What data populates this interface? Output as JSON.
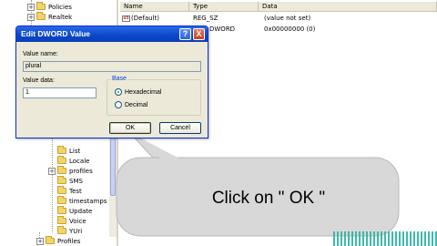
{
  "tree": {
    "top_items": [
      {
        "label": "Policies",
        "expander": "+"
      },
      {
        "label": "Realtek",
        "expander": "+"
      }
    ],
    "items": [
      {
        "label": "List",
        "expander": ""
      },
      {
        "label": "Locale",
        "expander": ""
      },
      {
        "label": "profiles",
        "expander": "+"
      },
      {
        "label": "SMS",
        "expander": ""
      },
      {
        "label": "Test",
        "expander": ""
      },
      {
        "label": "timestamps",
        "expander": ""
      },
      {
        "label": "Update",
        "expander": ""
      },
      {
        "label": "Voice",
        "expander": ""
      },
      {
        "label": "YUri",
        "expander": ""
      },
      {
        "label": "Profiles",
        "expander": "+"
      }
    ]
  },
  "list": {
    "columns": [
      "Name",
      "Type",
      "Data"
    ],
    "rows": [
      {
        "icon": "ab",
        "name": "(Default)",
        "type": "REG_SZ",
        "data": "(value not set)"
      },
      {
        "icon": "",
        "name": "",
        "type": "DWORD",
        "data": "0x00000000 (0)"
      }
    ]
  },
  "dialog": {
    "title": "Edit DWORD Value",
    "help_glyph": "?",
    "close_glyph": "X",
    "value_name_label": "Value name:",
    "value_name": "plural",
    "value_data_label": "Value data:",
    "value_data": "1",
    "base_label": "Base",
    "base_options": [
      {
        "label": "Hexadecimal",
        "selected": true
      },
      {
        "label": "Decimal",
        "selected": false
      }
    ],
    "ok_label": "OK",
    "cancel_label": "Cancel"
  },
  "callout": {
    "text": "Click on \" OK \""
  },
  "colors": {
    "title_bar": "#0a47c8",
    "dialog_bg": "#ece9d8",
    "callout_fill": "#d8d8d8",
    "folder": "#f2d46b"
  }
}
